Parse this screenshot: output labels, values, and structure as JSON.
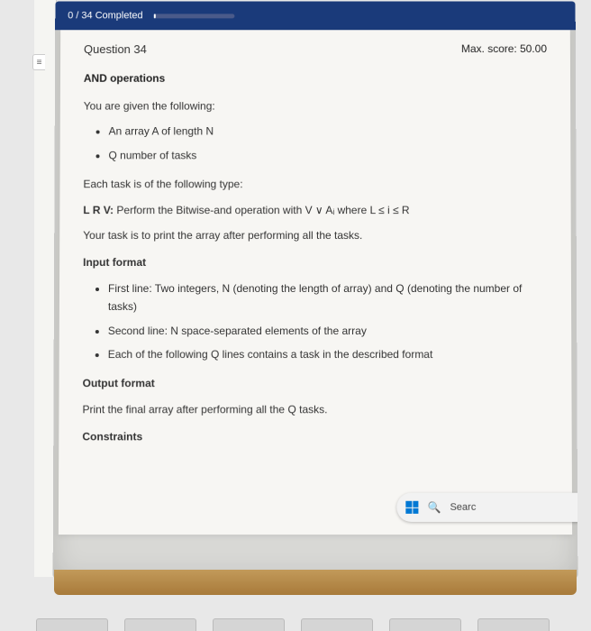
{
  "header": {
    "progress_text": "0 / 34 Completed"
  },
  "question": {
    "label": "Question  34",
    "max_score": "Max. score: 50.00",
    "title": "AND operations",
    "intro": "You are given the following:",
    "givens": [
      "An array A of length N",
      "Q number of tasks"
    ],
    "task_type_lead": "Each task is of the following type:",
    "task_line_prefix": "L R V:",
    "task_line_body": "Perform the Bitwise-and operation with V ∨ Aᵢ where L ≤ i ≤ R",
    "goal": "Your task is to print the array after performing all the tasks.",
    "input_heading": "Input format",
    "input_items": [
      "First line: Two integers, N (denoting the length of array) and Q (denoting the number of tasks)",
      "Second line: N space-separated elements of the array",
      "Each of the following Q lines contains a task in the described format"
    ],
    "output_heading": "Output format",
    "output_text": "Print the final array after performing all the Q tasks.",
    "constraints_heading": "Constraints"
  },
  "taskbar": {
    "search_label": "Searc"
  }
}
